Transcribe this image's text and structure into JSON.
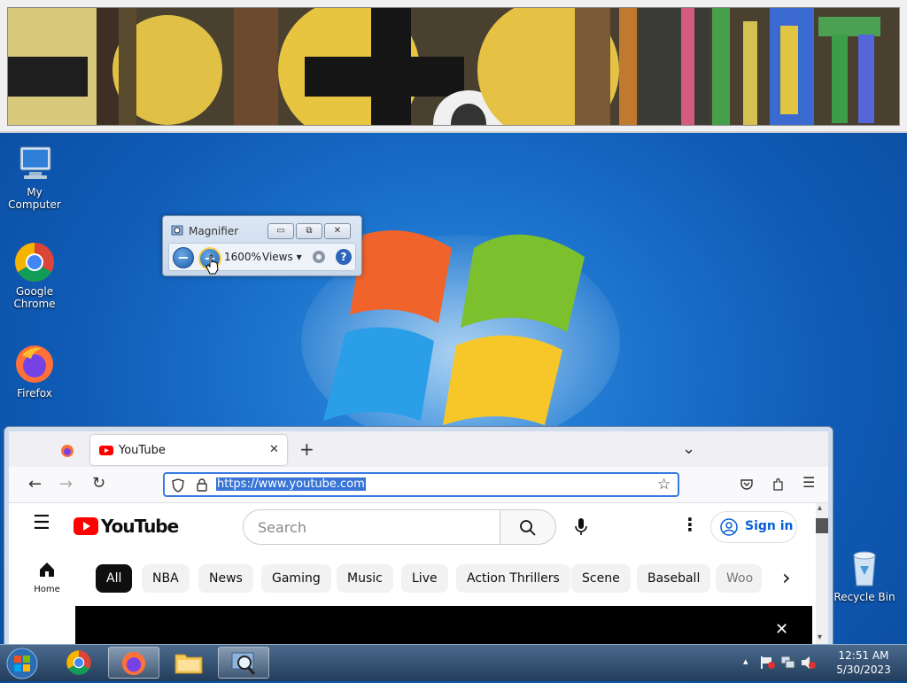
{
  "desktop": {
    "icons": [
      {
        "label": "My Computer",
        "icon": "computer-icon"
      },
      {
        "label": "Google Chrome",
        "line1": "Google",
        "line2": "Chrome",
        "icon": "chrome-icon"
      },
      {
        "label": "Firefox",
        "icon": "firefox-icon"
      },
      {
        "label": "Recycle Bin",
        "icon": "recycle-bin-icon"
      }
    ]
  },
  "magnifier": {
    "title": "Magnifier",
    "zoom": "1600%",
    "views_label": "Views",
    "minimize": "▭",
    "restore": "⧉",
    "close": "✕",
    "zoom_out_glyph": "−",
    "zoom_in_glyph": "+",
    "help_glyph": "?"
  },
  "firefox": {
    "tab_title": "YouTube",
    "tab_close": "✕",
    "new_tab": "+",
    "tabs_menu": "⌄",
    "url": "https://www.youtube.com",
    "back": "←",
    "forward": "→",
    "reload": "↻",
    "star": "☆",
    "menu": "☰"
  },
  "youtube": {
    "logo_text": "YouTube",
    "search_placeholder": "Search",
    "sign_in": "Sign in",
    "home_label": "Home",
    "chips": [
      "All",
      "NBA",
      "News",
      "Gaming",
      "Music",
      "Live",
      "Action Thrillers",
      "Scene",
      "Baseball",
      "Woo"
    ],
    "chip_next": "›"
  },
  "taskbar": {
    "time": "12:51 AM",
    "date": "5/30/2023",
    "tray_arrow": "▴"
  },
  "colors": {
    "youtube_red": "#ff0000",
    "sign_in_blue": "#065fd4",
    "url_highlight": "#3875d7",
    "url_border": "#3a7be0"
  }
}
